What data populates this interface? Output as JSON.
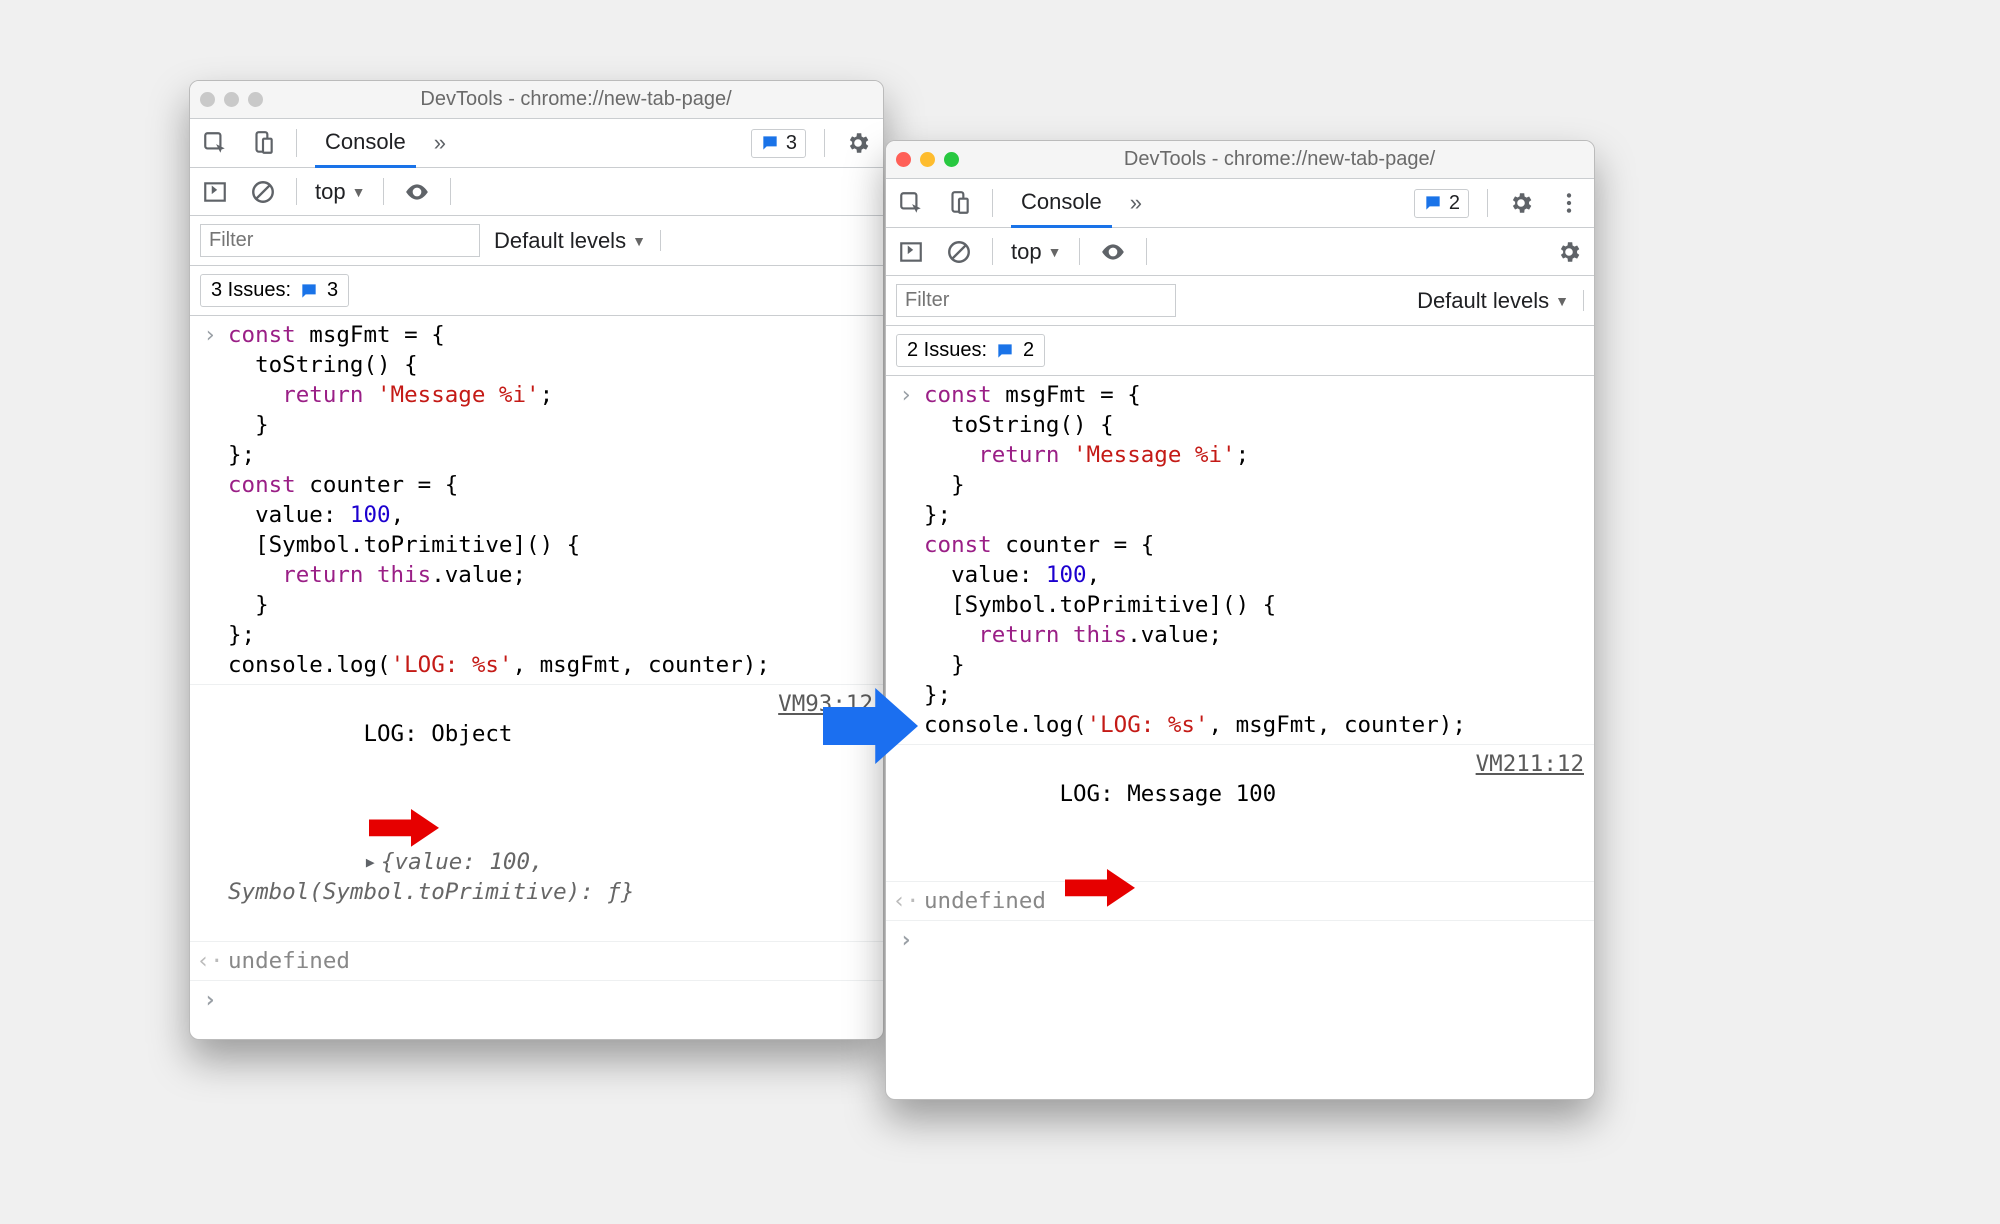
{
  "left": {
    "title": "DevTools - chrome://new-tab-page/",
    "tabs": {
      "console": "Console"
    },
    "badge_count": "3",
    "context": "top",
    "filter_placeholder": "Filter",
    "levels": "Default levels",
    "issues_label": "3 Issues:",
    "issues_count": "3",
    "code_lines": [
      {
        "t": "const msgFmt = {",
        "c": [
          [
            "kw",
            "const"
          ],
          [
            "",
            " msgFmt = {"
          ]
        ]
      },
      {
        "t": "  toString() {",
        "c": [
          [
            "",
            "  toString() {"
          ]
        ]
      },
      {
        "t": "    return 'Message %i';",
        "c": [
          [
            "",
            "    "
          ],
          [
            "kw",
            "return"
          ],
          [
            "",
            " "
          ],
          [
            "st",
            "'Message %i'"
          ],
          [
            "",
            ";"
          ]
        ]
      },
      {
        "t": "  }",
        "c": [
          [
            "",
            "  }"
          ]
        ]
      },
      {
        "t": "};",
        "c": [
          [
            "",
            "};"
          ]
        ]
      },
      {
        "t": "const counter = {",
        "c": [
          [
            "kw",
            "const"
          ],
          [
            "",
            " counter = {"
          ]
        ]
      },
      {
        "t": "  value: 100,",
        "c": [
          [
            "",
            "  value: "
          ],
          [
            "nm",
            "100"
          ],
          [
            "",
            ","
          ]
        ]
      },
      {
        "t": "  [Symbol.toPrimitive]() {",
        "c": [
          [
            "",
            "  [Symbol.toPrimitive]() {"
          ]
        ]
      },
      {
        "t": "    return this.value;",
        "c": [
          [
            "",
            "    "
          ],
          [
            "kw",
            "return"
          ],
          [
            "",
            " "
          ],
          [
            "kw",
            "this"
          ],
          [
            "",
            ".value;"
          ]
        ]
      },
      {
        "t": "  }",
        "c": [
          [
            "",
            "  }"
          ]
        ]
      },
      {
        "t": "};",
        "c": [
          [
            "",
            "};"
          ]
        ]
      },
      {
        "t": "console.log('LOG: %s', msgFmt, counter);",
        "c": [
          [
            "",
            "console.log("
          ],
          [
            "st",
            "'LOG: %s'"
          ],
          [
            "",
            ", msgFmt, counter);"
          ]
        ]
      }
    ],
    "log_line": "LOG: Object",
    "log_src": "VM93:12",
    "obj_preview": "{value: 100, Symbol(Symbol.toPrimitive): ƒ}",
    "result": "undefined"
  },
  "right": {
    "title": "DevTools - chrome://new-tab-page/",
    "tabs": {
      "console": "Console"
    },
    "badge_count": "2",
    "context": "top",
    "filter_placeholder": "Filter",
    "levels": "Default levels",
    "issues_label": "2 Issues:",
    "issues_count": "2",
    "log_line": "LOG: Message 100",
    "log_src": "VM211:12",
    "result": "undefined"
  }
}
